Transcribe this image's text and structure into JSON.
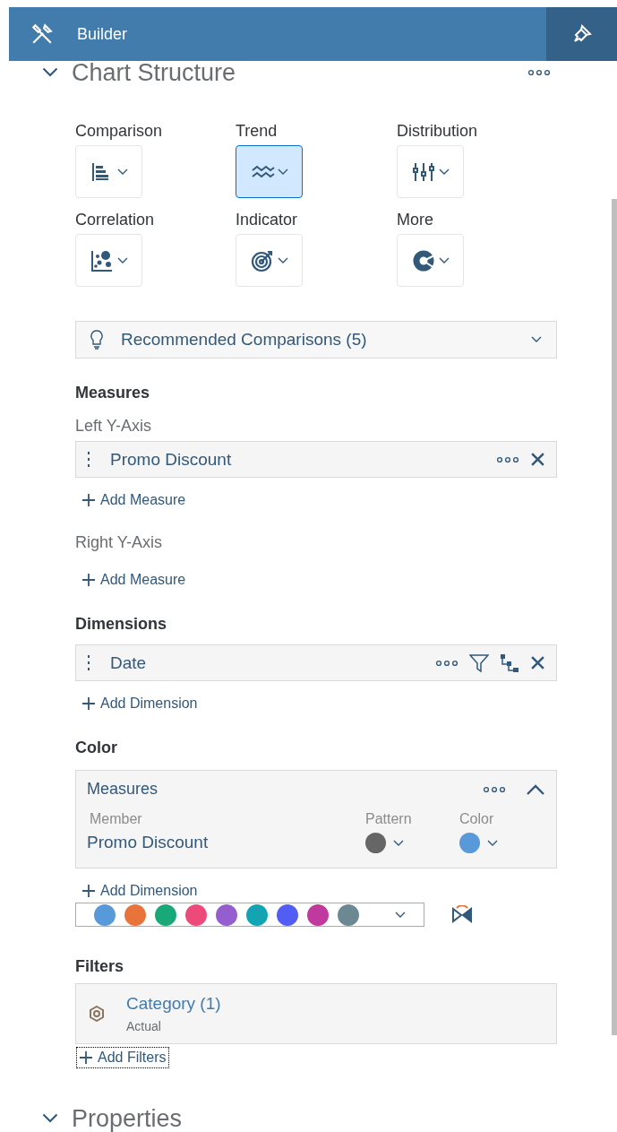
{
  "header": {
    "title": "Builder"
  },
  "chart_structure": {
    "title": "Chart Structure"
  },
  "chart_types": [
    {
      "label": "Comparison",
      "kind": "comparison",
      "selected": false
    },
    {
      "label": "Trend",
      "kind": "trend",
      "selected": true
    },
    {
      "label": "Distribution",
      "kind": "distribution",
      "selected": false
    },
    {
      "label": "Correlation",
      "kind": "correlation",
      "selected": false
    },
    {
      "label": "Indicator",
      "kind": "indicator",
      "selected": false
    },
    {
      "label": "More",
      "kind": "more",
      "selected": false
    }
  ],
  "recommendations": {
    "label": "Recommended Comparisons (5)"
  },
  "measures": {
    "heading": "Measures",
    "axes": [
      {
        "label": "Left Y-Axis",
        "items": [
          {
            "name": "Promo Discount"
          }
        ],
        "add": "Add Measure"
      },
      {
        "label": "Right Y-Axis",
        "add": "Add Measure"
      }
    ]
  },
  "dimensions": {
    "heading": "Dimensions",
    "items": [
      {
        "name": "Date"
      }
    ],
    "add": "Add Dimension"
  },
  "color": {
    "heading": "Color",
    "group": {
      "title": "Measures",
      "expanded": true,
      "columns": [
        "Member",
        "Pattern",
        "Color"
      ],
      "rows": [
        {
          "member": "Promo Discount",
          "color": "#5899da"
        }
      ]
    },
    "add": "Add Dimension",
    "palette": [
      {
        "color": "#5899da"
      },
      {
        "color": "#e8743b"
      },
      {
        "color": "#19a979"
      },
      {
        "color": "#ed4a7b"
      },
      {
        "color": "#945ecf"
      },
      {
        "color": "#13a4b4"
      },
      {
        "color": "#525df4"
      },
      {
        "color": "#bf399e"
      },
      {
        "color": "#6c8893"
      }
    ]
  },
  "filters": {
    "heading": "Filters",
    "items": [
      {
        "name": "Category (1)",
        "subtitle": "Actual"
      }
    ],
    "add": "Add Filters"
  },
  "properties": {
    "title": "Properties"
  }
}
